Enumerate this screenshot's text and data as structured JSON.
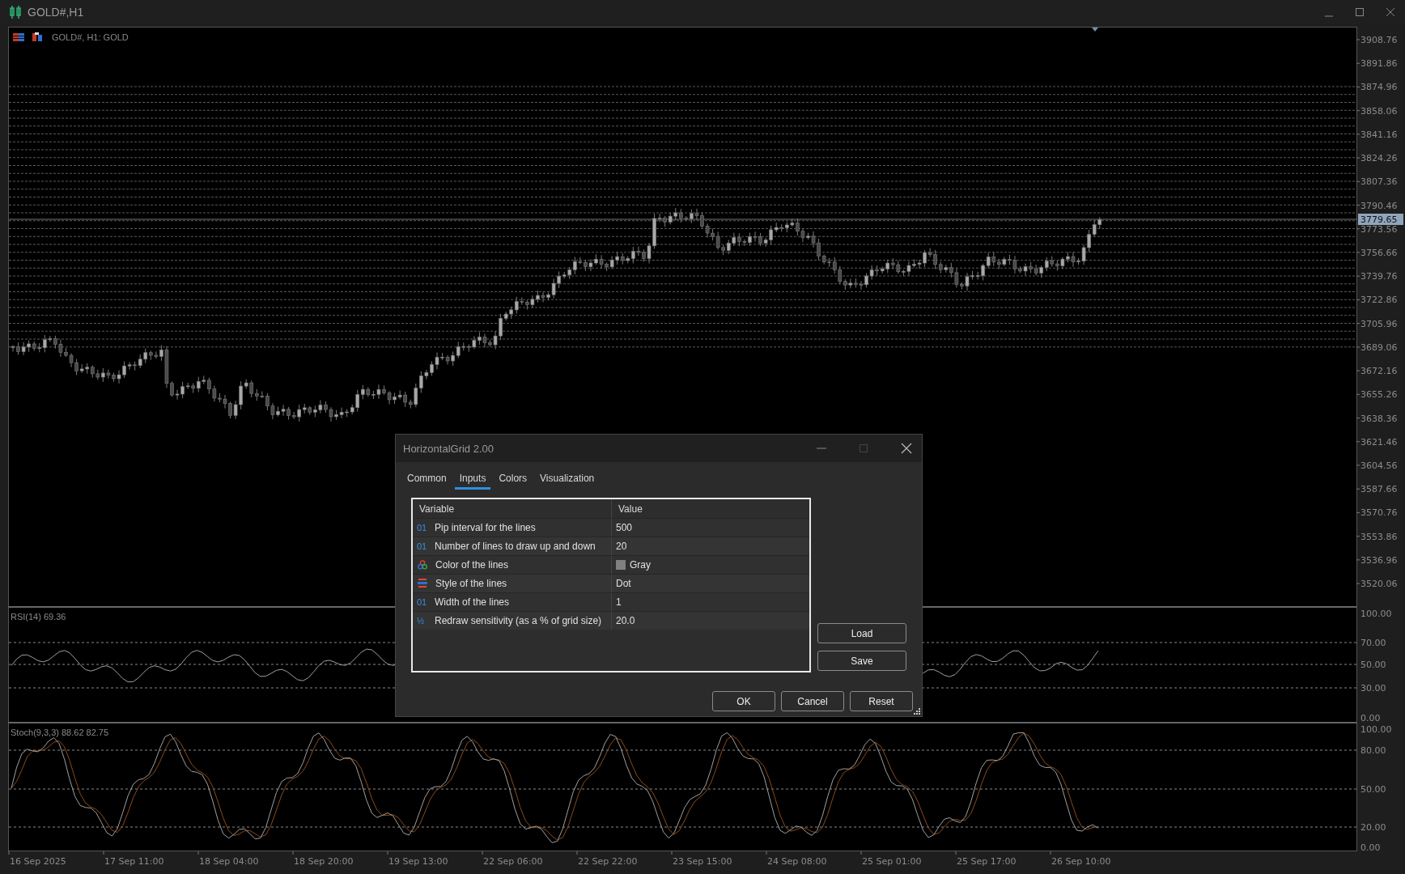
{
  "window": {
    "title": "GOLD#,H1"
  },
  "chart": {
    "header": "GOLD#, H1:  GOLD",
    "price_axis": [
      "3908.76",
      "3891.86",
      "3874.96",
      "3858.06",
      "3841.16",
      "3824.26",
      "3807.36",
      "3790.46",
      "3773.56",
      "3756.66",
      "3739.76",
      "3722.86",
      "3705.96",
      "3689.06",
      "3672.16",
      "3655.26",
      "3638.36",
      "3621.46",
      "3604.56",
      "3587.66",
      "3570.76",
      "3553.86",
      "3536.96",
      "3520.06"
    ],
    "current_price": "3779.65",
    "rsi": {
      "label": "RSI(14) 69.36",
      "axis": [
        "100.00",
        "70.00",
        "50.00",
        "30.00",
        "0.00"
      ]
    },
    "stoch": {
      "label": "Stoch(9,3,3) 88.62 82.75",
      "axis": [
        "100.00",
        "80.00",
        "50.00",
        "20.00",
        "0.00"
      ]
    },
    "time_axis": [
      "16 Sep 2025",
      "17 Sep 11:00",
      "18 Sep 04:00",
      "18 Sep 20:00",
      "19 Sep 13:00",
      "22 Sep 06:00",
      "22 Sep 22:00",
      "23 Sep 15:00",
      "24 Sep 08:00",
      "25 Sep 01:00",
      "25 Sep 17:00",
      "26 Sep 10:00"
    ]
  },
  "dialog": {
    "title": "HorizontalGrid 2.00",
    "tabs": [
      {
        "label": "Common",
        "selected": false
      },
      {
        "label": "Inputs",
        "selected": true
      },
      {
        "label": "Colors",
        "selected": false
      },
      {
        "label": "Visualization",
        "selected": false
      }
    ],
    "table": {
      "columns": [
        "Variable",
        "Value"
      ],
      "rows": [
        {
          "kind": "integer",
          "icon_text": "01",
          "variable": "Pip interval for the lines",
          "value": "500"
        },
        {
          "kind": "integer",
          "icon_text": "01",
          "variable": "Number of lines to draw up and down",
          "value": "20"
        },
        {
          "kind": "color",
          "variable": "Color of the lines",
          "value": "Gray",
          "color": "#808080"
        },
        {
          "kind": "style",
          "variable": "Style of the lines",
          "value": "Dot"
        },
        {
          "kind": "integer",
          "icon_text": "01",
          "variable": "Width of the lines",
          "value": "1"
        },
        {
          "kind": "double",
          "icon_text": "½",
          "variable": "Redraw sensitivity (as a % of grid size)",
          "value": "20.0"
        }
      ]
    },
    "side_buttons": [
      "Load",
      "Save"
    ],
    "buttons": [
      "OK",
      "Cancel",
      "Reset"
    ]
  }
}
